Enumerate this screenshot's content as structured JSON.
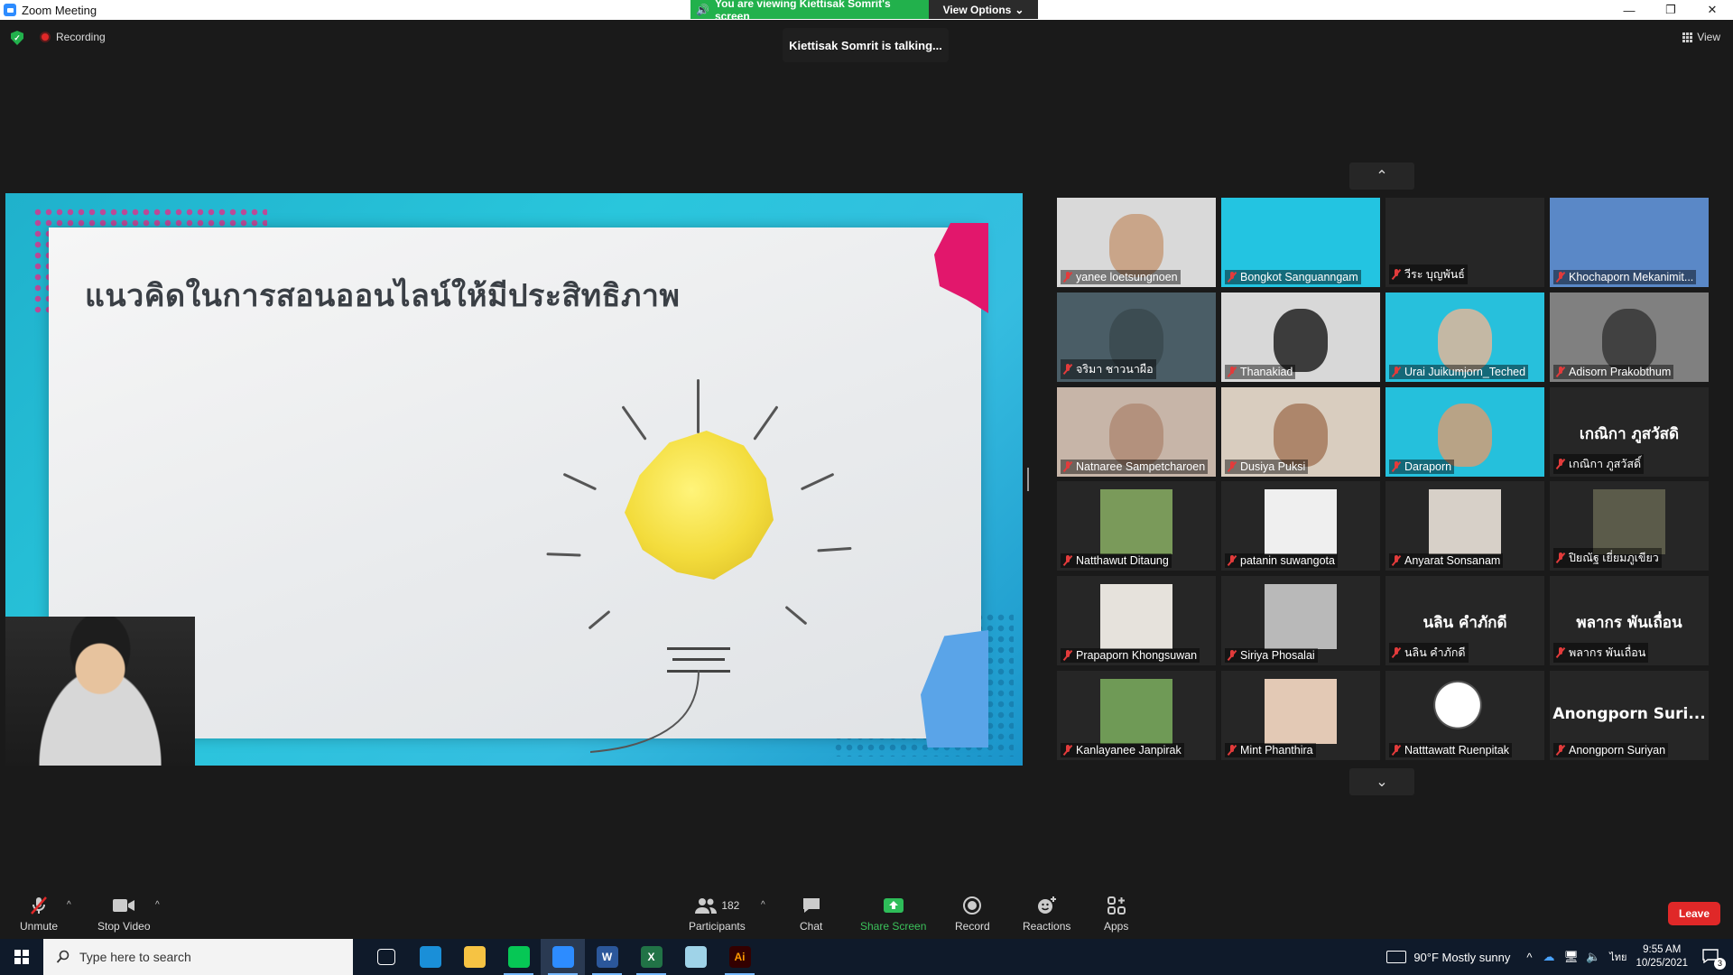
{
  "window": {
    "title": "Zoom Meeting",
    "controls": {
      "minimize": "—",
      "maximize": "❐",
      "close": "✕"
    }
  },
  "banner": {
    "viewing_text": "You are viewing Kiettisak Somrit's screen",
    "view_options": "View Options"
  },
  "overlay": {
    "recording": "Recording",
    "talking": "Kiettisak Somrit is talking...",
    "view": "View"
  },
  "slide": {
    "title": "แนวคิดในการสอนออนไลน์ให้มีประสิทธิภาพ"
  },
  "gallery": {
    "up_arrow": "⌃",
    "down_arrow": "⌄",
    "tiles": [
      {
        "name": "yanee loetsungnoen",
        "kind": "video",
        "bg": "#d9d9d9",
        "skin": "#c79e80"
      },
      {
        "name": "Bongkot Sanguanngam",
        "kind": "image",
        "bg": "#23c4e1"
      },
      {
        "name": "วีระ บุญพันธ์",
        "kind": "blank"
      },
      {
        "name": "Khochaporn Mekanimit...",
        "kind": "image",
        "bg": "#5a88c7"
      },
      {
        "name": "จริมา ชาวนาผือ",
        "kind": "video",
        "bg": "#4a5d66",
        "skin": "#3b4a50"
      },
      {
        "name": "Thanakiad",
        "kind": "video",
        "bg": "#d8d8d8",
        "skin": "#2b2b2b"
      },
      {
        "name": "Urai Juikumjorn_Teched",
        "kind": "image",
        "bg": "#27c0dc",
        "skin": "#d6b79d"
      },
      {
        "name": "Adisorn Prakobthum",
        "kind": "video",
        "bg": "#808080",
        "skin": "#3a3a3a"
      },
      {
        "name": "Natnaree Sampetcharoen",
        "kind": "video",
        "bg": "#c7b5a8",
        "skin": "#b08d78"
      },
      {
        "name": "Dusiya Puksi",
        "kind": "video",
        "bg": "#d9cdbf",
        "skin": "#a77e62"
      },
      {
        "name": "Daraporn",
        "kind": "image",
        "bg": "#25c0dc",
        "skin": "#c9a07c"
      },
      {
        "name": "เกณิกา ภูสวัสดิ์",
        "kind": "text",
        "display": "เกณิกา ภูสวัสดิ"
      },
      {
        "name": "Natthawut Ditaung",
        "kind": "photo",
        "bg": "#7a9a5a"
      },
      {
        "name": "patanin suwangota",
        "kind": "photo",
        "bg": "#efefef"
      },
      {
        "name": "Anyarat Sonsanam",
        "kind": "photo",
        "bg": "#d7d0c8"
      },
      {
        "name": "ปิยณัฐ เยี่ยมภูเขียว",
        "kind": "photo",
        "bg": "#5b5b4a"
      },
      {
        "name": "Prapaporn Khongsuwan",
        "kind": "photo",
        "bg": "#e6e2dc"
      },
      {
        "name": "Siriya Phosalai",
        "kind": "photo",
        "bg": "#b9b9b9"
      },
      {
        "name": "นลิน คำภักดี",
        "kind": "text",
        "display": "นลิน คำภักดี"
      },
      {
        "name": "พลากร พันเถื่อน",
        "kind": "text",
        "display": "พลากร พันเถื่อน"
      },
      {
        "name": "Kanlayanee Janpirak",
        "kind": "photo",
        "bg": "#6f9a56"
      },
      {
        "name": "Mint Phanthira",
        "kind": "photo",
        "bg": "#e3c9b5"
      },
      {
        "name": "Natttawatt Ruenpitak",
        "kind": "cartoon"
      },
      {
        "name": "Anongporn Suriyan",
        "kind": "text",
        "display": "Anongporn  Suri..."
      }
    ]
  },
  "toolbar": {
    "unmute": "Unmute",
    "stop_video": "Stop Video",
    "participants": "Participants",
    "participants_count": "182",
    "chat": "Chat",
    "share_screen": "Share Screen",
    "record": "Record",
    "reactions": "Reactions",
    "apps": "Apps",
    "leave": "Leave",
    "caret": "^"
  },
  "taskbar": {
    "search_placeholder": "Type here to search",
    "apps": [
      {
        "icon": "task-view-icon"
      },
      {
        "icon": "edge-icon",
        "color": "#1a8fd8"
      },
      {
        "icon": "file-explorer-icon",
        "color": "#f6c343"
      },
      {
        "icon": "line-icon",
        "color": "#06c755"
      },
      {
        "icon": "zoom-icon",
        "color": "#2d8cff"
      },
      {
        "icon": "word-icon",
        "color": "#2b579a",
        "glyph": "W"
      },
      {
        "icon": "excel-icon",
        "color": "#217346",
        "glyph": "X"
      },
      {
        "icon": "notepad-icon",
        "color": "#9fd3e8"
      },
      {
        "icon": "illustrator-icon",
        "color": "#330000",
        "glyph": "Ai"
      }
    ],
    "weather": "90°F  Mostly sunny",
    "lang": "ไทย",
    "time": "9:55 AM",
    "date": "10/25/2021",
    "notifications": "3"
  }
}
